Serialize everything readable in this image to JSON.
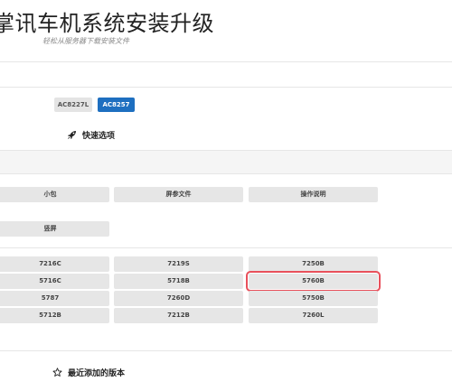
{
  "header": {
    "title": "掌讯车机系统安装升级",
    "subtitle": "轻松从服务器下载安装文件"
  },
  "model_tabs": [
    {
      "label": "AC8227L",
      "active": false
    },
    {
      "label": "AC8257",
      "active": true
    }
  ],
  "quick_options": {
    "title": "快速选项",
    "icon": "rocket-icon",
    "row1": [
      "小包",
      "屏参文件",
      "操作说明"
    ],
    "row2": [
      "竖屏"
    ]
  },
  "versions": {
    "grid": [
      [
        "7216C",
        "7219S",
        "7250B"
      ],
      [
        "5716C",
        "5718B",
        "5760B"
      ],
      [
        "5787",
        "7260D",
        "5750B"
      ],
      [
        "5712B",
        "7212B",
        "7260L"
      ]
    ],
    "selected": "5760B"
  },
  "recent": {
    "title": "最近添加的版本",
    "icon": "star-outline-icon"
  },
  "colors": {
    "accent": "#1e6fc0",
    "selected_outline": "#e8505b",
    "button_bg": "#e6e6e6"
  }
}
